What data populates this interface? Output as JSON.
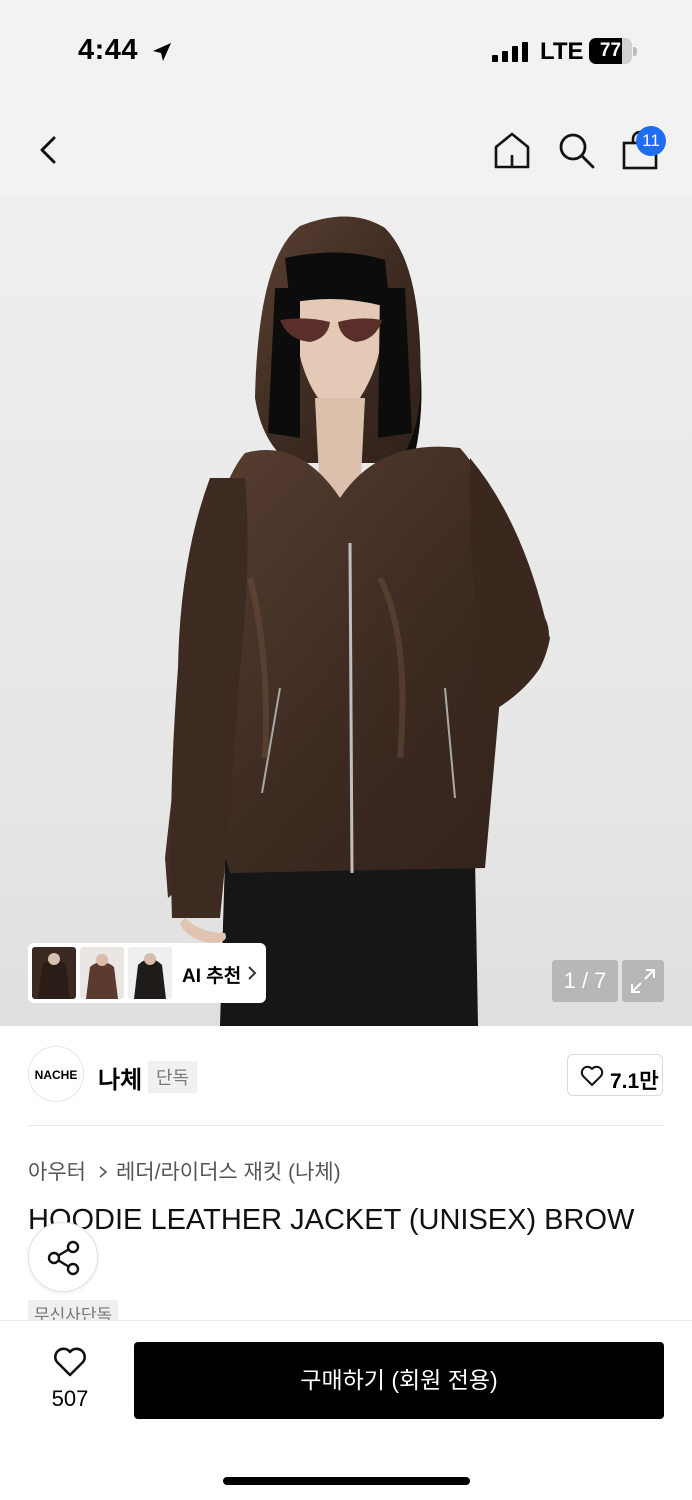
{
  "status_bar": {
    "time": "4:44",
    "network": "LTE",
    "battery": "77",
    "battery_level": 0.77
  },
  "nav": {
    "cart_count": "11"
  },
  "hero": {
    "ai_label": "AI 추천",
    "page_indicator": "1 / 7"
  },
  "brand": {
    "logo_text": "NACHE",
    "name": "나체",
    "tag": "단독",
    "like_count": "7.1만"
  },
  "breadcrumb": {
    "category": "아우터",
    "subcategory": "레더/라이더스 재킷 (나체)"
  },
  "product": {
    "title": "HOODIE LEATHER JACKET (UNISEX) BROW",
    "exclusive_tag": "무신사단독"
  },
  "bottom": {
    "favorite_count": "507",
    "buy_label": "구매하기 (회원 전용)"
  },
  "colors": {
    "badge_blue": "#1f6df3",
    "buy_button": "#000000",
    "leather_brown": "#4a3328"
  }
}
